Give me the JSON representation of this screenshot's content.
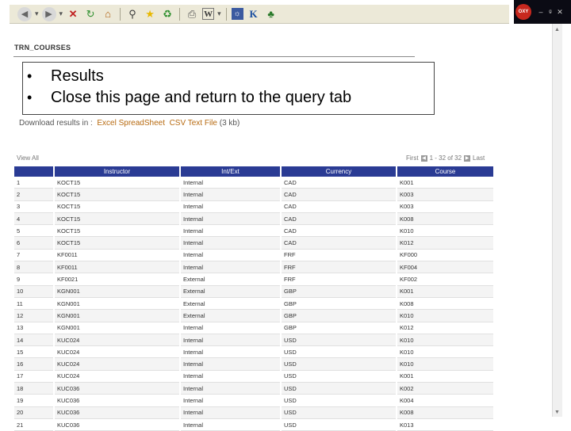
{
  "toolbar": {
    "icons": [
      "back-icon",
      "forward-icon",
      "stop-icon",
      "refresh-icon",
      "home-icon",
      "search-icon",
      "favorites-icon",
      "history-icon",
      "print-icon",
      "word-icon",
      "irc-icon",
      "ie-icon",
      "msn-icon"
    ]
  },
  "window_controls": {
    "logo": "OXY",
    "minimize": "–",
    "restore": "ᵍ",
    "close": "✕"
  },
  "page": {
    "title": "TRN_COURSES"
  },
  "callout": {
    "bullets": [
      "Results",
      "Close this page and return to the query tab"
    ]
  },
  "downloads": {
    "label": "Download results in :",
    "excel": "Excel SpreadSheet",
    "csv": "CSV Text File",
    "size": "(3 kb)"
  },
  "grid": {
    "view_all": "View All",
    "pager_first": "First",
    "pager_range": "1 - 32 of 32",
    "pager_last": "Last",
    "columns": [
      "",
      "Instructor",
      "Int/Ext",
      "Currency",
      "Course"
    ],
    "rows": [
      [
        "1",
        "KOCT15",
        "Internal",
        "CAD",
        "K001"
      ],
      [
        "2",
        "KOCT15",
        "Internal",
        "CAD",
        "K003"
      ],
      [
        "3",
        "KOCT15",
        "Internal",
        "CAD",
        "K003"
      ],
      [
        "4",
        "KOCT15",
        "Internal",
        "CAD",
        "K008"
      ],
      [
        "5",
        "KOCT15",
        "Internal",
        "CAD",
        "K010"
      ],
      [
        "6",
        "KOCT15",
        "Internal",
        "CAD",
        "K012"
      ],
      [
        "7",
        "KF0011",
        "Internal",
        "FRF",
        "KF000"
      ],
      [
        "8",
        "KF0011",
        "Internal",
        "FRF",
        "KF004"
      ],
      [
        "9",
        "KF0021",
        "External",
        "FRF",
        "KF002"
      ],
      [
        "10",
        "KGN001",
        "External",
        "GBP",
        "K001"
      ],
      [
        "11",
        "KGN001",
        "External",
        "GBP",
        "K008"
      ],
      [
        "12",
        "KGN001",
        "External",
        "GBP",
        "K010"
      ],
      [
        "13",
        "KGN001",
        "Internal",
        "GBP",
        "K012"
      ],
      [
        "14",
        "KUC024",
        "Internal",
        "USD",
        "K010"
      ],
      [
        "15",
        "KUC024",
        "Internal",
        "USD",
        "K010"
      ],
      [
        "16",
        "KUC024",
        "Internal",
        "USD",
        "K010"
      ],
      [
        "17",
        "KUC024",
        "Internal",
        "USD",
        "K001"
      ],
      [
        "18",
        "KUC036",
        "Internal",
        "USD",
        "K002"
      ],
      [
        "19",
        "KUC036",
        "Internal",
        "USD",
        "K004"
      ],
      [
        "20",
        "KUC036",
        "Internal",
        "USD",
        "K008"
      ],
      [
        "21",
        "KUC036",
        "Internal",
        "USD",
        "K013"
      ]
    ]
  }
}
